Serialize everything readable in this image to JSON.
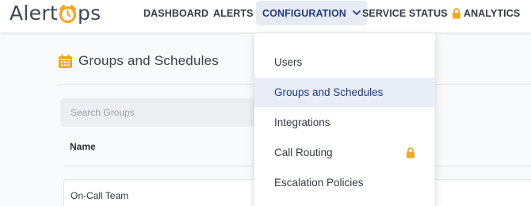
{
  "logo": {
    "part1": "Alert",
    "part2": "ps"
  },
  "nav": {
    "dashboard": "DASHBOARD",
    "alerts": "ALERTS",
    "configuration": "CONFIGURATION",
    "service_status": "SERVICE STATUS",
    "analytics": "ANALYTICS"
  },
  "page": {
    "title": "Groups and Schedules",
    "search_placeholder": "Search Groups",
    "column_name": "Name",
    "rows": [
      {
        "name": "On-Call Team"
      }
    ]
  },
  "dropdown": {
    "items": [
      {
        "label": "Users"
      },
      {
        "label": "Groups and Schedules",
        "selected": true
      },
      {
        "label": "Integrations"
      },
      {
        "label": "Call Routing",
        "locked": true
      },
      {
        "label": "Escalation Policies"
      }
    ]
  },
  "colors": {
    "accent_orange": "#f5a623",
    "active_nav_bg": "#e7ebf4",
    "active_text": "#1f3b8a"
  },
  "icons": {
    "logo_o": "alarm-clock-icon",
    "chevron": "chevron-down-icon",
    "lock": "lock-icon",
    "calendar": "calendar-icon"
  }
}
